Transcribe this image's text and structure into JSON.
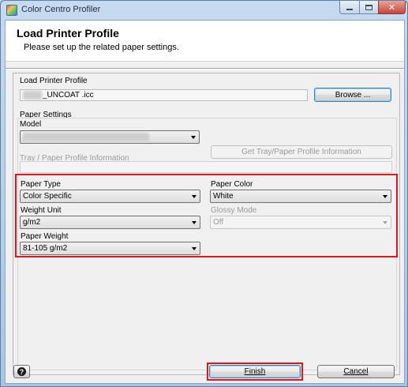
{
  "window": {
    "title": "Color Centro Profiler",
    "controls": {
      "minimize": "minimize",
      "maximize": "maximize",
      "close": "✕"
    }
  },
  "header": {
    "title": "Load Printer Profile",
    "subtitle": "Please set up the related paper settings."
  },
  "load_profile": {
    "label": "Load Printer Profile",
    "file_suffix": "_UNCOAT .icc",
    "browse_label": "Browse ..."
  },
  "paper_settings": {
    "label": "Paper Settings",
    "model_label": "Model",
    "tray_label": "Tray / Paper Profile Information",
    "get_tray_label": "Get Tray/Paper Profile Information",
    "paper_type_label": "Paper Type",
    "paper_type_value": "Color Specific",
    "paper_color_label": "Paper Color",
    "paper_color_value": "White",
    "weight_unit_label": "Weight Unit",
    "weight_unit_value": "g/m2",
    "glossy_mode_label": "Glossy Mode",
    "glossy_mode_value": "Off",
    "paper_weight_label": "Paper Weight",
    "paper_weight_value": "81-105 g/m2"
  },
  "footer": {
    "help_label": "?",
    "finish_label": "Finish",
    "cancel_label": "Cancel"
  },
  "colors": {
    "highlight": "#e3141b",
    "default_button": "#3c7fb1"
  },
  "icons": [
    "app-icon",
    "help-icon",
    "dropdown-arrow-icon"
  ]
}
